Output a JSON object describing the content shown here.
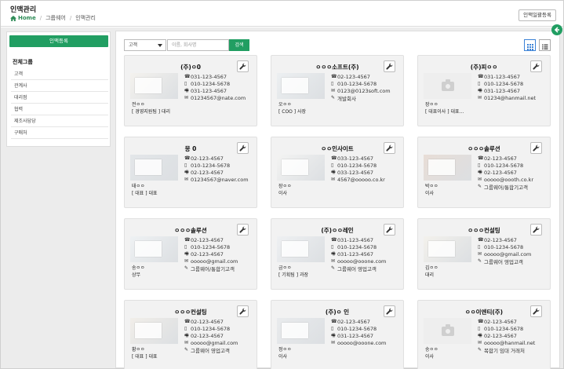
{
  "header": {
    "title": "인맥관리",
    "breadcrumb": [
      "Home",
      "그룹웨어",
      "인맥관리"
    ],
    "bulk_button": "인맥일괄등록"
  },
  "sidebar": {
    "register_button": "인맥등록",
    "group_title": "전체그룹",
    "groups": [
      "고객",
      "관계사",
      "대리점",
      "협력",
      "제조사담당",
      "구매처"
    ]
  },
  "toolbar": {
    "select_value": "고객",
    "search_placeholder": "이름, 회사명",
    "search_button": "검색",
    "grid_view_icon": "grid-view-icon",
    "list_view_icon": "list-view-icon"
  },
  "icons": {
    "phone": "phone-icon",
    "mobile": "mobile-icon",
    "fax": "fax-icon",
    "email": "email-icon",
    "pin": "pin-icon",
    "wrench": "wrench-icon",
    "back": "back-arrow-icon"
  },
  "colors": {
    "accent": "#219e62",
    "view_active": "#3b82d6"
  },
  "cards": [
    {
      "company": "(주)ㅇ0",
      "phone": "031-123-4567",
      "mobile": "010-1234-5678",
      "fax": "031-123-4567",
      "email": "01234567@nate.com",
      "person": "전ㅇㅇ",
      "title": "[ 경영지원팀 ] 대리",
      "group": "",
      "thumb": "card"
    },
    {
      "company": "ㅇㅇㅇ소프트(주)",
      "phone": "02-123-4567",
      "mobile": "010-1234-5678",
      "fax": "",
      "email": "0123@0123soft.com",
      "person": "오ㅇㅇ",
      "title": "[ COO ] 사장",
      "group": "개발회사",
      "thumb": "card"
    },
    {
      "company": "(주)피ㅇㅇ",
      "phone": "031-123-4567",
      "mobile": "010-1234-5678",
      "fax": "031-123-4567",
      "email": "01234@hanmail.net",
      "person": "장ㅇㅇ",
      "title": "[ 대표이사 ] 대표...",
      "group": "",
      "thumb": "placeholder"
    },
    {
      "company": "몽 0",
      "phone": "02-123-4567",
      "mobile": "010-1234-5678",
      "fax": "02-123-4567",
      "email": "01234567@naver.com",
      "person": "태ㅇㅇ",
      "title": "[ 대표 ] 대표",
      "group": "",
      "thumb": "card"
    },
    {
      "company": "ㅇㅇ인사이트",
      "phone": "033-123-4567",
      "mobile": "010-1234-5678",
      "fax": "033-123-4567",
      "email": "4567@ooooo.co.kr",
      "person": "장ㅇㅇ",
      "title": "이사",
      "group": "",
      "thumb": "card"
    },
    {
      "company": "ㅇㅇㅇ솔루션",
      "phone": "02-123-4567",
      "mobile": "010-1234-5678",
      "fax": "02-123-4567",
      "email": "ooooo@oooth.co.kr",
      "person": "박ㅇㅇ",
      "title": "이사",
      "group": "그룹웨어/통합기고객",
      "thumb": "card"
    },
    {
      "company": "ㅇㅇㅇ솔루션",
      "phone": "02-123-4567",
      "mobile": "010-1234-5678",
      "fax": "02-123-4567",
      "email": "ooooo@gmail.com",
      "person": "송ㅇㅇ",
      "title": "상무",
      "group": "그룹웨어/통합기고객",
      "thumb": "card"
    },
    {
      "company": "(주)ㅇㅇ레인",
      "phone": "031-123-4567",
      "mobile": "010-1234-5678",
      "fax": "031-123-4567",
      "email": "ooooo@ooone.com",
      "person": "금ㅇㅇ",
      "title": "[ 기획팀 ] 과장",
      "group": "그룹웨어 영업고객",
      "thumb": "card"
    },
    {
      "company": "ㅇㅇㅇ컨설팅",
      "phone": "02-123-4567",
      "mobile": "010-1234-5678",
      "fax": "",
      "email": "ooooo@gmail.com",
      "person": "김ㅇㅇ",
      "title": "대리",
      "group": "그룹웨어 영업고객",
      "thumb": "card"
    },
    {
      "company": "ㅇㅇㅇ컨설팅",
      "phone": "02-123-4567",
      "mobile": "010-1234-5678",
      "fax": "02-123-4567",
      "email": "ooooo@gmail.com",
      "person": "황ㅇㅇ",
      "title": "[ 대표 ] 대표",
      "group": "그룹웨어 영업고객",
      "thumb": "card"
    },
    {
      "company": "(주)ㅇ 인",
      "phone": "02-123-4567",
      "mobile": "010-1234-5678",
      "fax": "031-123-4567",
      "email": "ooooo@ooone.com",
      "person": "정ㅇㅇ",
      "title": "이사",
      "group": "",
      "thumb": "card"
    },
    {
      "company": "ㅇㅇ이엔티(주)",
      "phone": "02-123-4567",
      "mobile": "010-1234-5678",
      "fax": "02-123-4567",
      "email": "ooooo@hanmail.net",
      "person": "송ㅇㅇ",
      "title": "이사",
      "group": "복합기 임대 거래처",
      "thumb": "placeholder"
    }
  ]
}
